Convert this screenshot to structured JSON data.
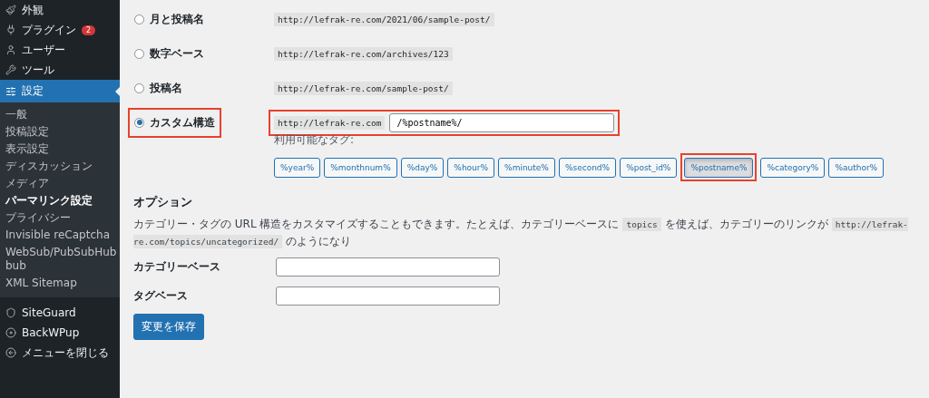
{
  "sidebar": {
    "top_items": [
      {
        "label": "外観",
        "selected": false
      },
      {
        "label": "プラグイン",
        "selected": false,
        "badge": "2"
      },
      {
        "label": "ユーザー",
        "selected": false
      },
      {
        "label": "ツール",
        "selected": false
      },
      {
        "label": "設定",
        "selected": true
      }
    ],
    "submenu": [
      {
        "label": "一般",
        "selected": false
      },
      {
        "label": "投稿設定",
        "selected": false
      },
      {
        "label": "表示設定",
        "selected": false
      },
      {
        "label": "ディスカッション",
        "selected": false
      },
      {
        "label": "メディア",
        "selected": false
      },
      {
        "label": "パーマリンク設定",
        "selected": true
      },
      {
        "label": "プライバシー",
        "selected": false
      },
      {
        "label": "Invisible reCaptcha",
        "selected": false
      },
      {
        "label": "WebSub/PubSubHub bub",
        "selected": false
      },
      {
        "label": "XML Sitemap",
        "selected": false
      }
    ],
    "bottom_items": [
      {
        "label": "SiteGuard"
      },
      {
        "label": "BackWPup"
      },
      {
        "label": "メニューを閉じる"
      }
    ]
  },
  "structures": [
    {
      "kind": "preset",
      "label": "月と投稿名",
      "selected": false,
      "example": "http://lefrak-re.com/2021/06/sample-post/"
    },
    {
      "kind": "preset",
      "label": "数字ベース",
      "selected": false,
      "example": "http://lefrak-re.com/archives/123"
    },
    {
      "kind": "preset",
      "label": "投稿名",
      "selected": false,
      "example": "http://lefrak-re.com/sample-post/"
    },
    {
      "kind": "custom",
      "label": "カスタム構造",
      "selected": true,
      "highlighted": true,
      "prefix": "http://lefrak-re.com",
      "value": "/%postname%/"
    }
  ],
  "available_tags": {
    "label": "利用可能なタグ:",
    "tags": [
      {
        "label": "%year%",
        "selected": false
      },
      {
        "label": "%monthnum%",
        "selected": false
      },
      {
        "label": "%day%",
        "selected": false
      },
      {
        "label": "%hour%",
        "selected": false
      },
      {
        "label": "%minute%",
        "selected": false
      },
      {
        "label": "%second%",
        "selected": false
      },
      {
        "label": "%post_id%",
        "selected": false
      },
      {
        "label": "%postname%",
        "selected": true,
        "highlighted": true
      },
      {
        "label": "%category%",
        "selected": false
      },
      {
        "label": "%author%",
        "selected": false
      }
    ]
  },
  "options": {
    "heading": "オプション",
    "description": [
      {
        "kind": "text",
        "text": "カテゴリー・タグの URL 構造をカスタマイズすることもできます。たとえば、カテゴリーベースに"
      },
      {
        "kind": "code",
        "text": "topics"
      },
      {
        "kind": "text",
        "text": "を使えば、カテゴリーのリンクが"
      },
      {
        "kind": "code",
        "text": "http://lefrak-re.com/topics/uncategorized/"
      },
      {
        "kind": "text",
        "text": "のようになり"
      }
    ],
    "fields": [
      {
        "label": "カテゴリーベース"
      },
      {
        "label": "タグベース"
      }
    ]
  },
  "save_button": "変更を保存"
}
